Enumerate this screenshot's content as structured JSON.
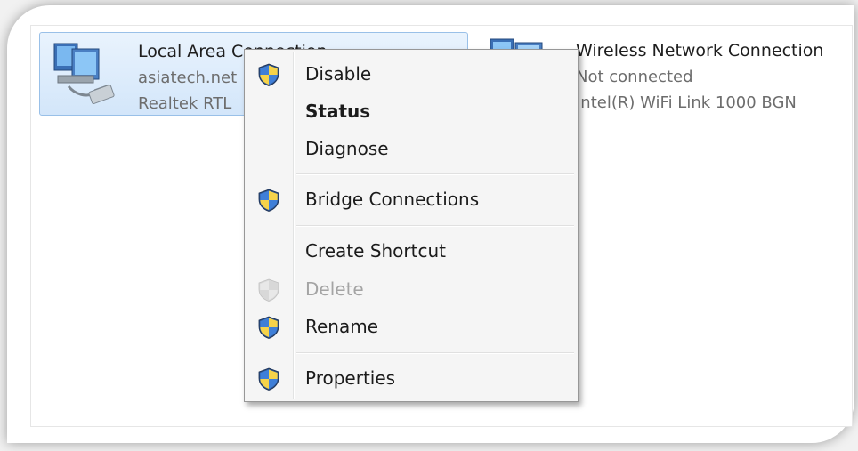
{
  "connections": [
    {
      "name": "Local Area Connection",
      "line1": "asiatech.net",
      "line2": "Realtek RTL",
      "icon": "wired-network-adapter-icon",
      "selected": true
    },
    {
      "name": "Wireless Network Connection",
      "line1": "Not connected",
      "line2": "Intel(R) WiFi Link 1000 BGN",
      "icon": "wireless-network-adapter-icon",
      "selected": false
    }
  ],
  "context_menu": {
    "items": [
      {
        "label": "Disable",
        "icon": "uac-shield-icon",
        "bold": false,
        "enabled": true
      },
      {
        "label": "Status",
        "icon": null,
        "bold": true,
        "enabled": true
      },
      {
        "label": "Diagnose",
        "icon": null,
        "bold": false,
        "enabled": true
      },
      {
        "label": "Bridge Connections",
        "icon": "uac-shield-icon",
        "bold": false,
        "enabled": true
      },
      {
        "label": "Create Shortcut",
        "icon": null,
        "bold": false,
        "enabled": true
      },
      {
        "label": "Delete",
        "icon": "uac-shield-icon",
        "bold": false,
        "enabled": false
      },
      {
        "label": "Rename",
        "icon": "uac-shield-icon",
        "bold": false,
        "enabled": true
      },
      {
        "label": "Properties",
        "icon": "uac-shield-icon",
        "bold": false,
        "enabled": true
      }
    ]
  },
  "colors": {
    "selection_fill": "#d3e6fa",
    "selection_border": "#99c0e8",
    "menu_background": "#f5f5f5",
    "disabled_text": "#a4a4a4"
  }
}
